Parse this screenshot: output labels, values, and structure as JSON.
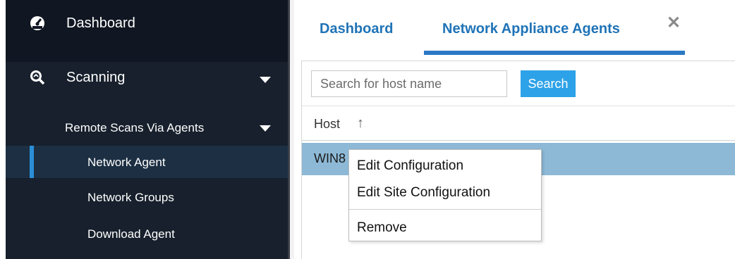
{
  "sidebar": {
    "dashboard_label": "Dashboard",
    "scanning_label": "Scanning",
    "remote_scans_label": "Remote Scans Via Agents",
    "items": [
      {
        "label": "Network Agent",
        "active": true
      },
      {
        "label": "Network Groups",
        "active": false
      },
      {
        "label": "Download Agent",
        "active": false
      }
    ],
    "icons": {
      "dashboard": "gauge-icon",
      "scanning": "scan-magnifier-icon"
    }
  },
  "tabs": [
    {
      "label": "Dashboard",
      "active": false
    },
    {
      "label": "Network Appliance Agents",
      "active": true
    }
  ],
  "tab_close": "✕",
  "search": {
    "placeholder": "Search for host name",
    "button_label": "Search"
  },
  "table": {
    "columns": [
      "Host"
    ],
    "sort_indicator": "↑",
    "rows": [
      {
        "host": "WIN8",
        "selected": true
      }
    ]
  },
  "context_menu": {
    "items": [
      "Edit Configuration",
      "Edit Site Configuration",
      "Remove"
    ]
  },
  "colors": {
    "sidebar_bg": "#17202c",
    "active_accent": "#2b8fd8",
    "tab_text": "#1f73b7",
    "search_button": "#2ea2e8",
    "selected_row": "#8db9d6"
  }
}
